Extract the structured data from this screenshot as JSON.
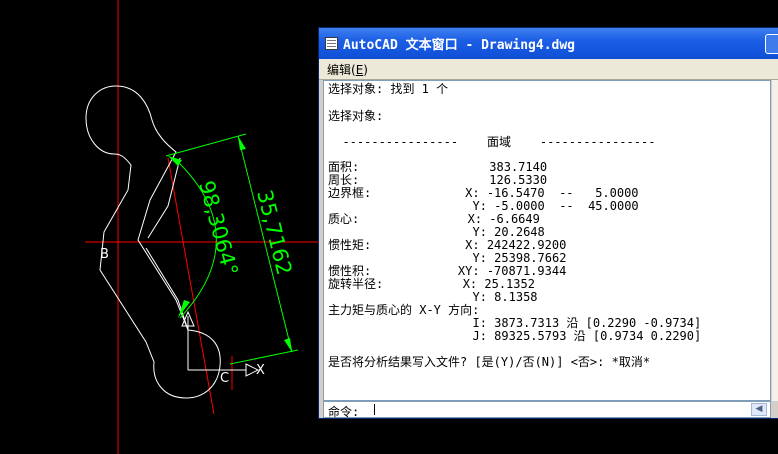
{
  "drawing": {
    "dim_angle": "98,3064°",
    "dim_length": "35,7162",
    "label_b": "B",
    "label_c": "C",
    "ucs_x": "X",
    "colors": {
      "crosshair": "#ff0000",
      "dimension": "#00ff00",
      "profile": "#ffffff"
    }
  },
  "window": {
    "title": "AutoCAD 文本窗口 - Drawing4.dwg",
    "menu_edit": "编辑(",
    "menu_edit_key": "E",
    "menu_edit_close": ")"
  },
  "text_lines": [
    "选择对象: 找到 1 个",
    "选择对象:",
    "  ----------------    面域    ----------------",
    "面积:                  383.7140",
    "周长:                  126.5330",
    "边界框:             X: -16.5470  --   5.0000",
    "                    Y: -5.0000  --  45.0000",
    "质心:               X: -6.6649",
    "                    Y: 20.2648",
    "惯性矩:             X: 242422.9200",
    "                    Y: 25398.7662",
    "惯性积:            XY: -70871.9344",
    "旋转半径:           X: 25.1352",
    "                    Y: 8.1358",
    "主力矩与质心的 X-Y 方向:",
    "                    I: 3873.7313 沿 [0.2290 -0.9734]",
    "                    J: 89325.5793 沿 [0.9734 0.2290]",
    "是否将分析结果写入文件? [是(Y)/否(N)] <否>: *取消*"
  ],
  "command": {
    "prompt": "命令:",
    "value": ""
  }
}
